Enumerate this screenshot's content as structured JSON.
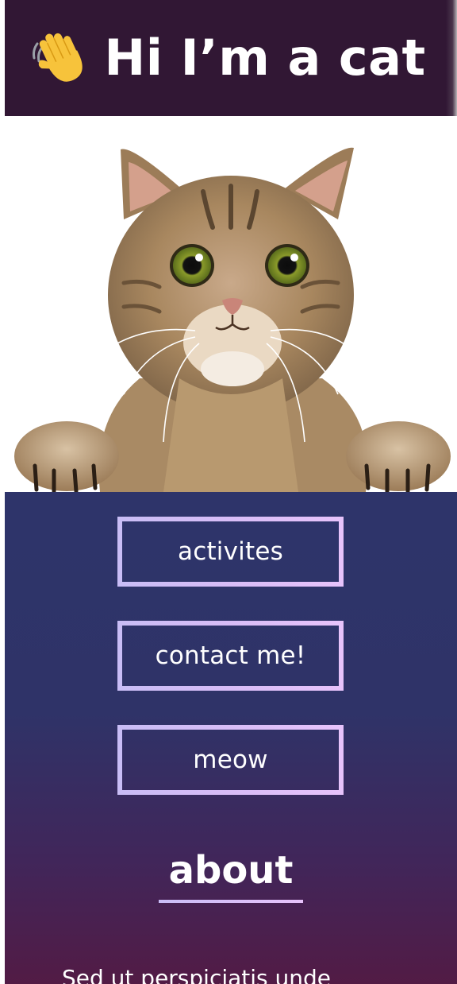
{
  "header": {
    "emoji_icon": "waving-hand-icon",
    "title": "Hi I’m a cat"
  },
  "hero": {
    "image_description": "photo-of-a-tabby-cat-peeking-over-an-edge"
  },
  "nav": {
    "buttons": [
      {
        "label": "activites"
      },
      {
        "label": "contact me!"
      },
      {
        "label": "meow"
      }
    ]
  },
  "about": {
    "heading": "about",
    "body_partial": "Sed ut perspiciatis unde"
  },
  "colors": {
    "header_bg": "#311734",
    "section_top": "#2e346a",
    "section_bottom": "#521b45",
    "button_border_start": "#c9bdf6",
    "button_border_end": "#e7c3fb"
  }
}
